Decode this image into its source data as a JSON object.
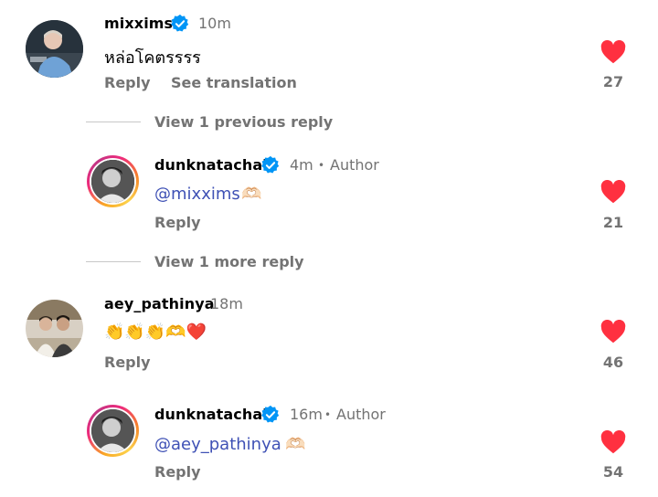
{
  "comments": [
    {
      "username": "mixxims",
      "time": "10m",
      "text": "หล่อโคตรรรร",
      "actions": {
        "reply": "Reply",
        "translate": "See translation"
      },
      "likes": "27",
      "verified": true
    },
    {
      "username": "dunknatachai",
      "time": "4m",
      "role": "Author",
      "mention": "@mixxims",
      "emoji": "🫶🏻",
      "actions": {
        "reply": "Reply"
      },
      "likes": "21",
      "verified": true
    },
    {
      "username": "aey_pathinya",
      "time": "18m",
      "emoji_text": "👏👏👏🫶❤️",
      "actions": {
        "reply": "Reply"
      },
      "likes": "46",
      "verified": false
    },
    {
      "username": "dunknatachai",
      "time": "16m",
      "role": "Author",
      "mention": "@aey_pathinya",
      "emoji": "🫶🏻",
      "actions": {
        "reply": "Reply"
      },
      "likes": "54",
      "verified": true
    }
  ],
  "thread_links": {
    "previous": "View 1 previous reply",
    "more": "View 1 more reply"
  },
  "separator_dot": "•",
  "colors": {
    "heart": "#ff3040",
    "verified": "#0095f6",
    "mention": "#3f51b5",
    "muted": "#737373"
  },
  "icons": {
    "heart": "heart-icon",
    "verified": "verified-badge-icon"
  }
}
